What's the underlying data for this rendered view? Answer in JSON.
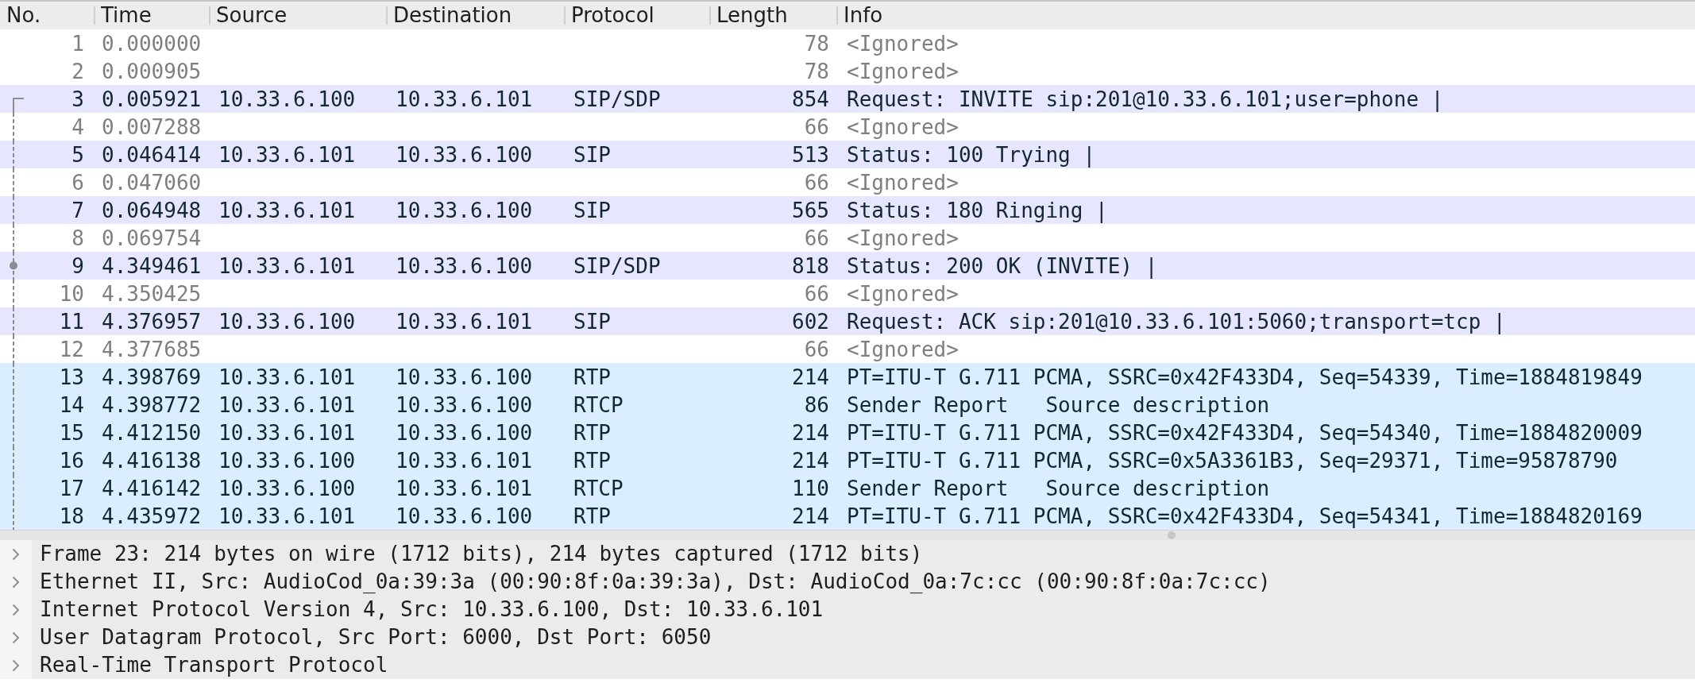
{
  "columns": [
    {
      "label": "No."
    },
    {
      "label": "Time"
    },
    {
      "label": "Source"
    },
    {
      "label": "Destination"
    },
    {
      "label": "Protocol"
    },
    {
      "label": "Length"
    },
    {
      "label": "Info"
    }
  ],
  "rows": [
    {
      "no": "1",
      "time": "0.000000",
      "length": "78",
      "info": "<Ignored>",
      "color": "#ffffff",
      "ignored": true
    },
    {
      "no": "2",
      "time": "0.000905",
      "length": "78",
      "info": "<Ignored>",
      "color": "#ffffff",
      "ignored": true
    },
    {
      "no": "3",
      "time": "0.005921",
      "source": "10.33.6.100",
      "destination": "10.33.6.101",
      "protocol": "SIP/SDP",
      "length": "854",
      "info": "Request: INVITE sip:201@10.33.6.101;user=phone |",
      "color": "#e7e6ff",
      "ignored": false,
      "marker": {
        "kind": "start"
      }
    },
    {
      "no": "4",
      "time": "0.007288",
      "length": "66",
      "info": "<Ignored>",
      "color": "#ffffff",
      "ignored": true,
      "marker": {
        "kind": "line"
      }
    },
    {
      "no": "5",
      "time": "0.046414",
      "source": "10.33.6.101",
      "destination": "10.33.6.100",
      "protocol": "SIP",
      "length": "513",
      "info": "Status: 100 Trying |",
      "color": "#e7e6ff",
      "ignored": false,
      "marker": {
        "kind": "line"
      }
    },
    {
      "no": "6",
      "time": "0.047060",
      "length": "66",
      "info": "<Ignored>",
      "color": "#ffffff",
      "ignored": true,
      "marker": {
        "kind": "line"
      }
    },
    {
      "no": "7",
      "time": "0.064948",
      "source": "10.33.6.101",
      "destination": "10.33.6.100",
      "protocol": "SIP",
      "length": "565",
      "info": "Status: 180 Ringing |",
      "color": "#e7e6ff",
      "ignored": false,
      "marker": {
        "kind": "line"
      }
    },
    {
      "no": "8",
      "time": "0.069754",
      "length": "66",
      "info": "<Ignored>",
      "color": "#ffffff",
      "ignored": true,
      "marker": {
        "kind": "line"
      }
    },
    {
      "no": "9",
      "time": "4.349461",
      "source": "10.33.6.101",
      "destination": "10.33.6.100",
      "protocol": "SIP/SDP",
      "length": "818",
      "info": "Status: 200 OK (INVITE) |",
      "color": "#e7e6ff",
      "ignored": false,
      "marker": {
        "kind": "dot"
      }
    },
    {
      "no": "10",
      "time": "4.350425",
      "length": "66",
      "info": "<Ignored>",
      "color": "#ffffff",
      "ignored": true,
      "marker": {
        "kind": "line"
      }
    },
    {
      "no": "11",
      "time": "4.376957",
      "source": "10.33.6.100",
      "destination": "10.33.6.101",
      "protocol": "SIP",
      "length": "602",
      "info": "Request: ACK sip:201@10.33.6.101:5060;transport=tcp |",
      "color": "#e7e6ff",
      "ignored": false,
      "marker": {
        "kind": "line"
      }
    },
    {
      "no": "12",
      "time": "4.377685",
      "length": "66",
      "info": "<Ignored>",
      "color": "#ffffff",
      "ignored": true,
      "marker": {
        "kind": "line"
      }
    },
    {
      "no": "13",
      "time": "4.398769",
      "source": "10.33.6.101",
      "destination": "10.33.6.100",
      "protocol": "RTP",
      "length": "214",
      "info": "PT=ITU-T G.711 PCMA, SSRC=0x42F433D4, Seq=54339, Time=1884819849",
      "color": "#daeeff",
      "ignored": false,
      "marker": {
        "kind": "line"
      }
    },
    {
      "no": "14",
      "time": "4.398772",
      "source": "10.33.6.101",
      "destination": "10.33.6.100",
      "protocol": "RTCP",
      "length": "86",
      "info": "Sender Report   Source description",
      "color": "#daeeff",
      "ignored": false,
      "marker": {
        "kind": "line"
      }
    },
    {
      "no": "15",
      "time": "4.412150",
      "source": "10.33.6.101",
      "destination": "10.33.6.100",
      "protocol": "RTP",
      "length": "214",
      "info": "PT=ITU-T G.711 PCMA, SSRC=0x42F433D4, Seq=54340, Time=1884820009",
      "color": "#daeeff",
      "ignored": false,
      "marker": {
        "kind": "line"
      }
    },
    {
      "no": "16",
      "time": "4.416138",
      "source": "10.33.6.100",
      "destination": "10.33.6.101",
      "protocol": "RTP",
      "length": "214",
      "info": "PT=ITU-T G.711 PCMA, SSRC=0x5A3361B3, Seq=29371, Time=95878790",
      "color": "#daeeff",
      "ignored": false,
      "marker": {
        "kind": "line"
      }
    },
    {
      "no": "17",
      "time": "4.416142",
      "source": "10.33.6.100",
      "destination": "10.33.6.101",
      "protocol": "RTCP",
      "length": "110",
      "info": "Sender Report   Source description",
      "color": "#daeeff",
      "ignored": false,
      "marker": {
        "kind": "line"
      }
    },
    {
      "no": "18",
      "time": "4.435972",
      "source": "10.33.6.101",
      "destination": "10.33.6.100",
      "protocol": "RTP",
      "length": "214",
      "info": "PT=ITU-T G.711 PCMA, SSRC=0x42F433D4, Seq=54341, Time=1884820169",
      "color": "#daeeff",
      "ignored": false,
      "marker": {
        "kind": "line"
      }
    }
  ],
  "details": [
    {
      "text": "Frame 23: 214 bytes on wire (1712 bits), 214 bytes captured (1712 bits)",
      "expanded": false
    },
    {
      "text": "Ethernet II, Src: AudioCod_0a:39:3a (00:90:8f:0a:39:3a), Dst: AudioCod_0a:7c:cc (00:90:8f:0a:7c:cc)",
      "expanded": false
    },
    {
      "text": "Internet Protocol Version 4, Src: 10.33.6.100, Dst: 10.33.6.101",
      "expanded": false
    },
    {
      "text": "User Datagram Protocol, Src Port: 6000, Dst Port: 6050",
      "expanded": false
    },
    {
      "text": "Real-Time Transport Protocol",
      "expanded": false
    }
  ]
}
